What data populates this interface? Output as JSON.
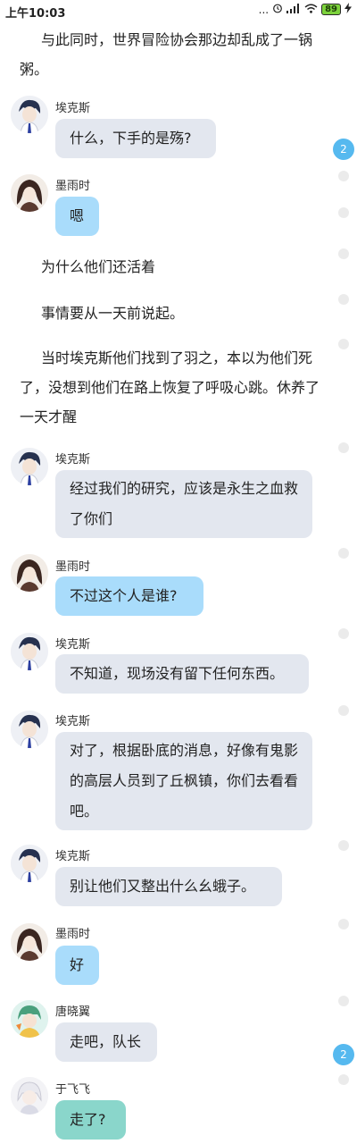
{
  "status_bar": {
    "time": "上午10:03",
    "signal_text": "...",
    "battery": "89"
  },
  "feed": {
    "narration": [
      "与此同时，世界冒险协会那边却乱成了一锅粥。",
      "为什么他们还活着",
      "事情要从一天前说起。",
      "当时埃克斯他们找到了羽之，本以为他们死了，没想到他们在路上恢复了呼吸心跳。休养了一天才醒"
    ],
    "messages": [
      {
        "speaker": "埃克斯",
        "text": "什么，下手的是殇?"
      },
      {
        "speaker": "墨雨时",
        "text": "嗯"
      },
      {
        "speaker": "埃克斯",
        "text": "经过我们的研究，应该是永生之血救了你们"
      },
      {
        "speaker": "墨雨时",
        "text": "不过这个人是谁?"
      },
      {
        "speaker": "埃克斯",
        "text": "不知道，现场没有留下任何东西。"
      },
      {
        "speaker": "埃克斯",
        "text": "对了，根据卧底的消息，好像有鬼影的高层人员到了丘枫镇，你们去看看吧。"
      },
      {
        "speaker": "埃克斯",
        "text": "别让他们又整出什么幺蛾子。"
      },
      {
        "speaker": "墨雨时",
        "text": "好"
      },
      {
        "speaker": "唐晓翼",
        "text": "走吧，队长"
      },
      {
        "speaker": "于飞飞",
        "text": "走了?"
      }
    ],
    "badges": [
      "2",
      "2"
    ]
  }
}
